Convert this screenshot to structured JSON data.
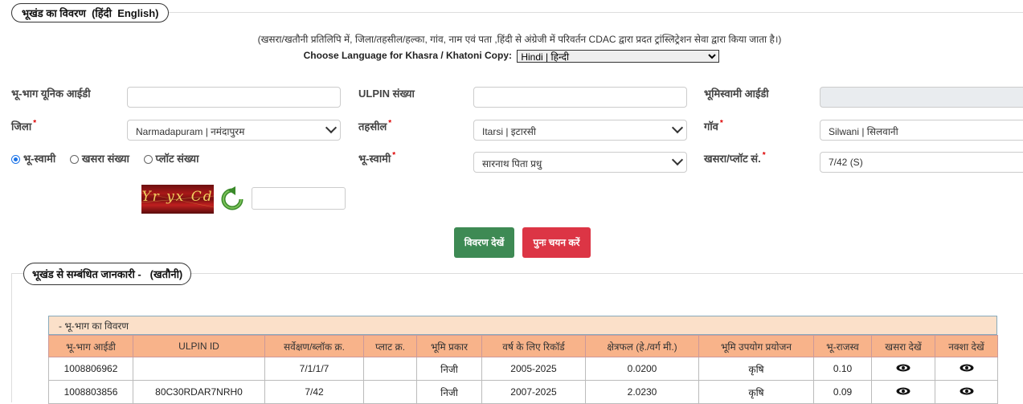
{
  "section1": {
    "legend_title": "भूखंड का विवरण",
    "legend_lang_hi": "हिंदी",
    "legend_lang_en": "English",
    "note": "(खसरा/खतौनी प्रतिलिपि में, जिला/तहसील/हल्का, गांव, नाम एवं पता ,हिंदी से अंग्रेजी में परिवर्तन CDAC द्वारा प्रदत ट्रांस्लिट्रेशन सेवा द्वारा किया जाता है।)",
    "language_label": "Choose Language for Khasra / Khatoni Copy:",
    "language_value": "Hindi | हिन्दी"
  },
  "form": {
    "unique_id_label": "भू-भाग यूनिक आईडी",
    "ulpin_label": "ULPIN संख्या",
    "owner_id_label": "भूमिस्वामी आईडी",
    "district_label": "जिला",
    "district_value": "Narmadapuram | नमंदापुरम",
    "tehsil_label": "तहसील",
    "tehsil_value": "Itarsi | इटारसी",
    "village_label": "गाॅव",
    "village_value": "Silwani | सिलवानी",
    "radio_owner": "भू-स्वामी",
    "radio_khasra": "खसरा संख्या",
    "radio_plot": "प्लॉट संख्या",
    "owner_label": "भू-स्वामी",
    "owner_value": "सारनाथ पिता प्रधु",
    "khasra_label": "खसरा/प्लॉट सं.",
    "khasra_value": "7/42 (S)",
    "required_mark": "*",
    "captcha_text": "Yr yx Cd"
  },
  "buttons": {
    "view_label": "विवरण देखें",
    "reset_label": "पुनः चयन करें"
  },
  "section2": {
    "legend_title": "भूखंड से सम्बंधित जानकारी -",
    "legend_sub": "(खतौनी)",
    "table_caption": "- भू-भाग का विवरण"
  },
  "table": {
    "headers": [
      "भू-भाग आईडी",
      "ULPIN ID",
      "सर्वेक्षण/ब्लॉक क्र.",
      "प्लाट क्र.",
      "भूमि प्रकार",
      "वर्ष के लिए रिकॉर्ड",
      "क्षेत्रफल (हे./वर्ग मी.)",
      "भूमि उपयोग प्रयोजन",
      "भू-राजस्व",
      "खसरा देखें",
      "नक्शा देखें"
    ],
    "rows": [
      [
        "1008806962",
        "",
        "7/1/1/7",
        "",
        "निजी",
        "2005-2025",
        "0.0200",
        "कृषि",
        "0.10"
      ],
      [
        "1008803856",
        "80C30RDAR7NRH0",
        "7/42",
        "",
        "निजी",
        "2007-2025",
        "2.0230",
        "कृषि",
        "0.09"
      ]
    ]
  },
  "colors": {
    "green_button": "#3e8a54",
    "red_button": "#dc3545",
    "table_header": "#f8b38a",
    "table_caption_bg": "#fbe0c9"
  }
}
